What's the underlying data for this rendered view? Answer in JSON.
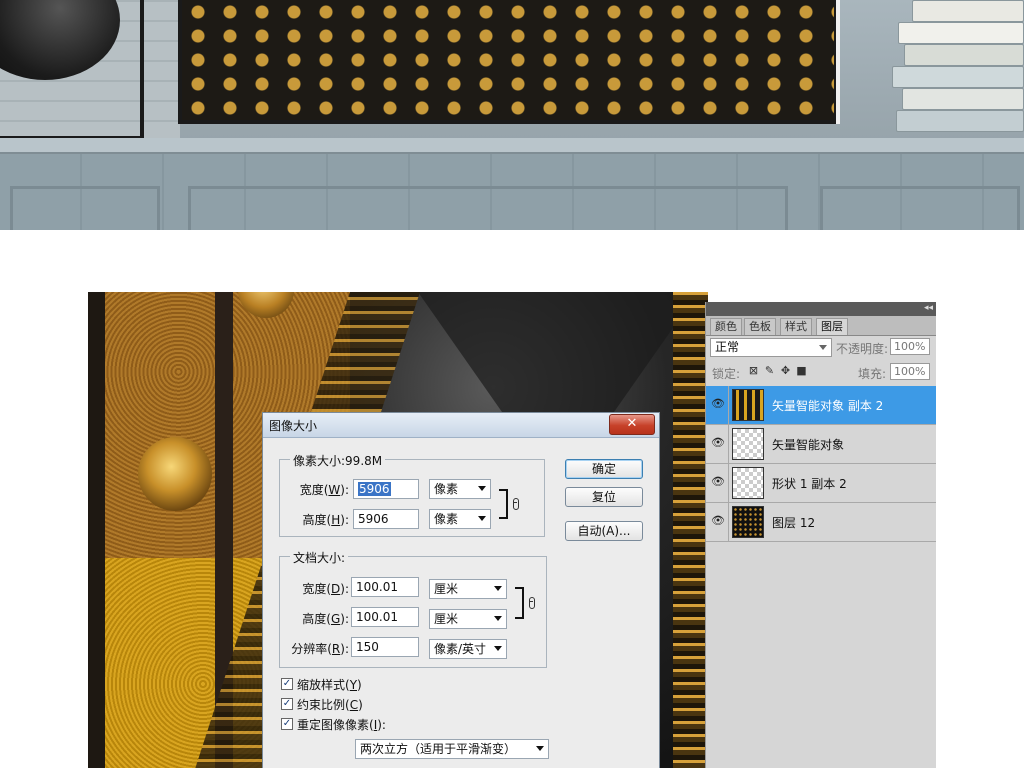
{
  "dialog": {
    "title": "图像大小",
    "close_glyph": "✕",
    "pixel_dimensions": {
      "legend": "像素大小:99.8M",
      "width_label": "宽度(",
      "width_key": "W",
      "width_value": "5906",
      "width_unit": "像素",
      "height_label": "高度(",
      "height_key": "H",
      "height_value": "5906",
      "height_unit": "像素",
      "label_suffix": "):"
    },
    "document_size": {
      "legend": "文档大小:",
      "width_label": "宽度(",
      "width_key": "D",
      "width_value": "100.01",
      "width_unit": "厘米",
      "height_label": "高度(",
      "height_key": "G",
      "height_value": "100.01",
      "height_unit": "厘米",
      "resolution_label": "分辨率(",
      "resolution_key": "R",
      "resolution_value": "150",
      "resolution_unit": "像素/英寸",
      "label_suffix": "):"
    },
    "buttons": {
      "ok": "确定",
      "reset": "复位",
      "auto": "自动(A)..."
    },
    "options": {
      "scale_styles": {
        "label": "缩放样式(",
        "key": "Y",
        "suffix": ")",
        "checked": true
      },
      "constrain_proportions": {
        "label": "约束比例(",
        "key": "C",
        "suffix": ")",
        "checked": true
      },
      "resample": {
        "label": "重定图像像素(",
        "key": "I",
        "suffix": "):",
        "checked": true
      },
      "resample_method": "两次立方（适用于平滑渐变）"
    }
  },
  "layers_panel": {
    "tabs": [
      "颜色",
      "色板",
      "样式",
      "图层"
    ],
    "active_tab": "图层",
    "blend_mode": "正常",
    "opacity_label": "不透明度:",
    "opacity_value": "100%",
    "lock_label": "锁定:",
    "fill_label": "填充:",
    "fill_value": "100%",
    "layers": [
      {
        "name": "矢量智能对象 副本 2",
        "visible": true,
        "selected": true
      },
      {
        "name": "矢量智能对象",
        "visible": true,
        "selected": false
      },
      {
        "name": "形状 1 副本 2",
        "visible": true,
        "selected": false
      },
      {
        "name": "图层 12",
        "visible": true,
        "selected": false
      }
    ]
  },
  "colors": {
    "selected_layer": "#3d9ae6",
    "close_button": "#c7422a",
    "dialog_bg": "#ececec",
    "gold": "#d9a520"
  },
  "icons": {
    "eye": "eye-icon",
    "chain": "chain-link-icon",
    "checkmark": "checkmark-icon",
    "lock_transparent": "lock-transparent-pixels-icon",
    "lock_image": "lock-image-pixels-icon",
    "lock_position": "lock-position-icon",
    "lock_all": "lock-all-icon"
  }
}
